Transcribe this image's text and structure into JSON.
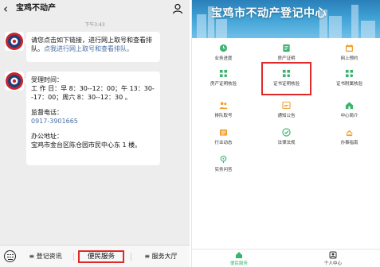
{
  "chat": {
    "title": "宝鸡不动产",
    "timestamp": "下午3:43",
    "message1": {
      "text": "请您点击如下链接，进行网上取号和查看排队。",
      "link": "点我进行网上取号和查看排队。"
    },
    "message2": {
      "hours_label": "受理时间：",
      "hours_text": "工 作 日：早 8：30--12：00；午 13：30--17：00；周六 8：30--12：30 。",
      "phone_label": "监督电话：",
      "phone": "0917-3901665",
      "address_label": "办公地址：",
      "address": "宝鸡市金台区陈仓园市民中心东 1 楼。"
    },
    "menu": [
      {
        "label": "≡ 登记资讯"
      },
      {
        "label": "便民服务"
      },
      {
        "label": "≡ 服务大厅"
      }
    ]
  },
  "app": {
    "banner_title": "宝鸡市不动产登记中心",
    "colors": {
      "banner": "#3ea0d4",
      "accent": "#3bb46e",
      "icon_orange": "#f3a033",
      "highlight": "#e02a2a"
    },
    "items": [
      {
        "label": "业务进度",
        "icon": "clock-icon"
      },
      {
        "label": "房产证明",
        "icon": "certificate-icon"
      },
      {
        "label": "网上预约",
        "icon": "calendar-icon"
      },
      {
        "label": "房产证明核验",
        "icon": "verify-icon"
      },
      {
        "label": "证书证明核验",
        "icon": "verify-icon"
      },
      {
        "label": "证书附属核验",
        "icon": "verify-icon"
      },
      {
        "label": "排队取号",
        "icon": "queue-icon"
      },
      {
        "label": "通知公告",
        "icon": "notice-icon"
      },
      {
        "label": "中心简介",
        "icon": "home-icon"
      },
      {
        "label": "行业动态",
        "icon": "news-icon"
      },
      {
        "label": "法律法规",
        "icon": "law-icon"
      },
      {
        "label": "办事指南",
        "icon": "guide-icon"
      },
      {
        "label": "实务问答",
        "icon": "qa-icon"
      }
    ],
    "tabs": [
      {
        "label": "便民服务",
        "icon": "service-icon"
      },
      {
        "label": "个人中心",
        "icon": "person-icon"
      }
    ]
  }
}
